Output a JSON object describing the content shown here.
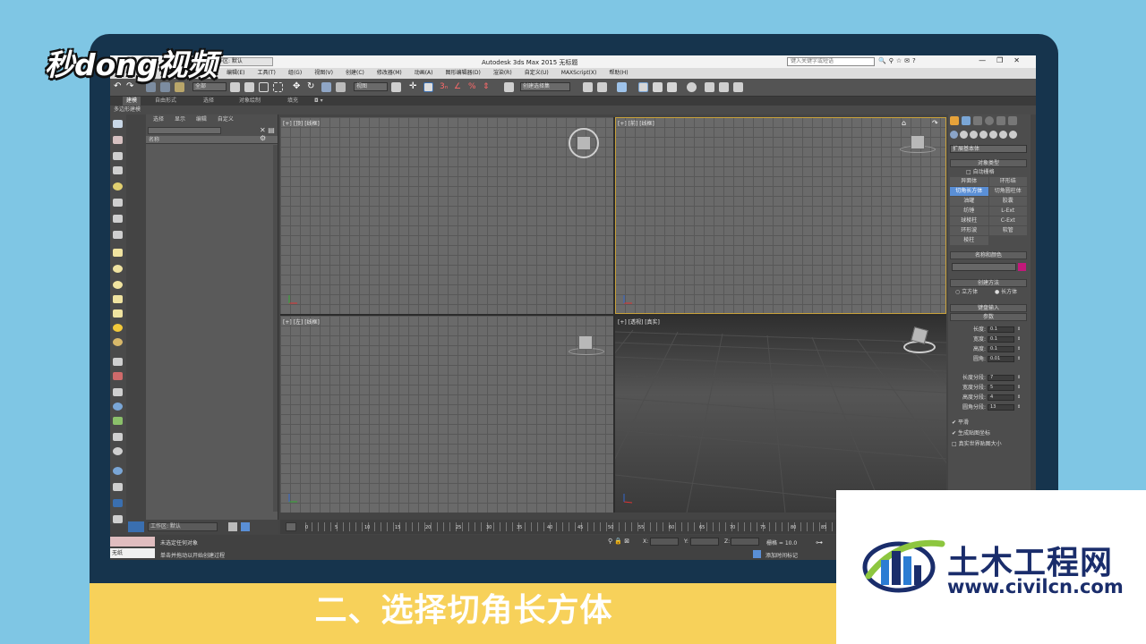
{
  "brand": {
    "logo_text": "秒dong视频"
  },
  "app": {
    "title": "Autodesk 3ds Max 2015    无标题",
    "workspace_label": "工作区: 默认",
    "search_placeholder": "键入关键字或短语",
    "window_controls": [
      "—",
      "❐",
      "✕"
    ]
  },
  "menubar": [
    "编辑(E)",
    "工具(T)",
    "组(G)",
    "视图(V)",
    "创建(C)",
    "修改器(M)",
    "动画(A)",
    "图形编辑器(D)",
    "渲染(R)",
    "自定义(U)",
    "MAXScript(X)",
    "帮助(H)"
  ],
  "toolbar": {
    "selection_filter": "全部",
    "ref_coord": "视图",
    "named_selection": "创建选择集"
  },
  "ribbon": {
    "tabs": [
      "建模",
      "自由形式",
      "选择",
      "对象绘制",
      "填充"
    ],
    "sub_label": "多边形建模"
  },
  "scene_explorer": {
    "tabs": [
      "选择",
      "显示",
      "编辑",
      "自定义"
    ],
    "column_name": "名称"
  },
  "viewports": {
    "top": "[+] [顶] [线框]",
    "front": "[+] [前] [线框]",
    "left": "[+] [左] [线框]",
    "perspective": "[+] [透视] [真实]"
  },
  "command_panel": {
    "category_dropdown": "扩展基本体",
    "object_type_header": "对象类型",
    "autogrid_label": "自动栅格",
    "buttons": [
      "异面体",
      "环形结",
      "切角长方体",
      "切角圆柱体",
      "油罐",
      "胶囊",
      "纺锤",
      "L-Ext",
      "球棱柱",
      "C-Ext",
      "环形波",
      "软管",
      "棱柱"
    ],
    "selected_button": "切角长方体",
    "name_color_header": "名称和颜色",
    "object_color": "#c2187a",
    "creation_method_header": "创建方法",
    "creation_methods": [
      "立方体",
      "长方体"
    ],
    "creation_method_selected": "长方体",
    "keyboard_entry_header": "键盘输入",
    "parameters_header": "参数",
    "params": [
      {
        "name": "长度:",
        "value": "0.1"
      },
      {
        "name": "宽度:",
        "value": "0.1"
      },
      {
        "name": "高度:",
        "value": "0.1"
      },
      {
        "name": "圆角:",
        "value": "0.01"
      }
    ],
    "segments": [
      {
        "name": "长度分段:",
        "value": "7"
      },
      {
        "name": "宽度分段:",
        "value": "5"
      },
      {
        "name": "高度分段:",
        "value": "4"
      },
      {
        "name": "圆角分段:",
        "value": "13"
      }
    ],
    "checkboxes": [
      {
        "label": "平滑",
        "checked": true
      },
      {
        "label": "生成贴图坐标",
        "checked": true
      },
      {
        "label": "真实世界贴图大小",
        "checked": false
      }
    ]
  },
  "timeline": {
    "ticks": [
      "0",
      "5",
      "10",
      "15",
      "20",
      "25",
      "30",
      "35",
      "40",
      "45",
      "50",
      "55",
      "60",
      "65",
      "70",
      "75",
      "80",
      "85"
    ],
    "workspace": "工作区: 默认"
  },
  "status": {
    "layer_name": "无纸",
    "message_top": "未选定任何对象",
    "message_bottom": "单击并拖动以开始创建过程",
    "x_label": "X:",
    "y_label": "Y:",
    "z_label": "Z:",
    "grid": "栅格 = 10.0",
    "add_time_tag": "添加时间标记"
  },
  "caption": "二、选择切角长方体",
  "watermark": {
    "name": "土木工程网",
    "url": "www.civilcn.com"
  },
  "colors": {
    "background": "#7fc6e4",
    "caption_bar": "#f7d15a",
    "monitor_bezel": "#16344d",
    "active_viewport": "#c9a23a",
    "selected_button": "#5a8fd6",
    "watermark_text": "#1a2d6b"
  }
}
